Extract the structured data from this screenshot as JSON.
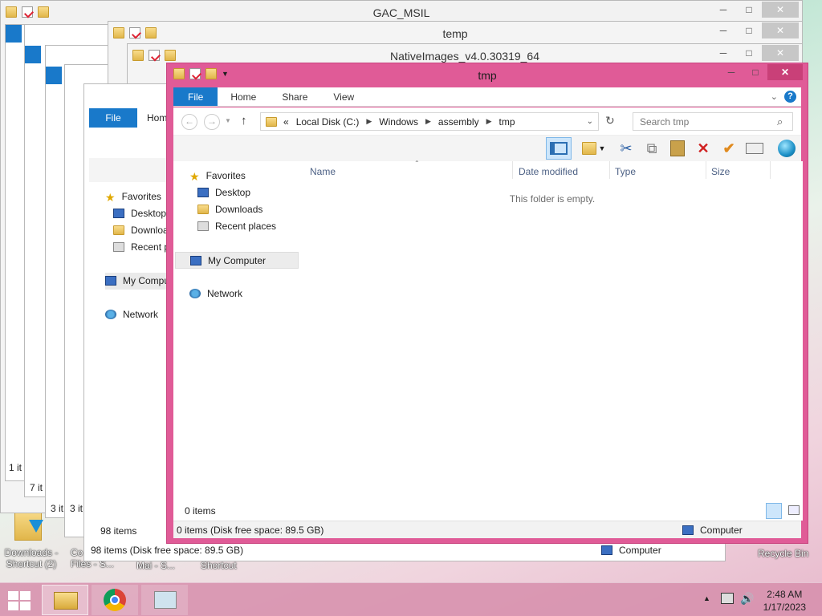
{
  "bg_windows": {
    "gac_title": "GAC_MSIL",
    "temp_title": "temp",
    "native_title": "NativeImages_v4.0.30319_64",
    "left_nav": {
      "favorites": "Favorites",
      "desktop": "Desktop",
      "downloads": "Downloa",
      "recent": "Recent p",
      "computer": "My Compu",
      "network": "Network"
    },
    "left_file_tab": "File",
    "left_home_tab": "Home",
    "status_98": "98 items",
    "status_98_full": "98 items (Disk free space: 89.5 GB)",
    "status_computer": "Computer",
    "stack_counts": [
      "1 it",
      "7 it",
      "3 it",
      "3 it",
      "3 it"
    ]
  },
  "window": {
    "title": "tmp",
    "minimize": "─",
    "maximize": "□",
    "close": "✕"
  },
  "ribbon": {
    "tabs": [
      "File",
      "Home",
      "Share",
      "View"
    ],
    "help": "?"
  },
  "address": {
    "back": "←",
    "forward": "→",
    "up": "↑",
    "crumbs": [
      "«",
      "Local Disk (C:)",
      "Windows",
      "assembly",
      "tmp"
    ],
    "search_placeholder": "Search tmp"
  },
  "nav_pane": {
    "favorites": "Favorites",
    "desktop": "Desktop",
    "downloads": "Downloads",
    "recent": "Recent places",
    "computer": "My Computer",
    "network": "Network"
  },
  "columns": [
    "Name",
    "Date modified",
    "Type",
    "Size"
  ],
  "empty_message": "This folder is empty.",
  "footer_count": "0 items",
  "status": {
    "left": "0 items (Disk free space: 89.5 GB)",
    "right": "Computer"
  },
  "desktop": {
    "downloads_shortcut": "Downloads -\nShortcut (2)",
    "recycle_bin": "Recycle Bin",
    "partial_1": "Co\nFiles - S...",
    "partial_2": "Mai - S...",
    "partial_3": "Shortcut"
  },
  "taskbar": {
    "time": "2:48 AM",
    "date": "1/17/2023"
  }
}
